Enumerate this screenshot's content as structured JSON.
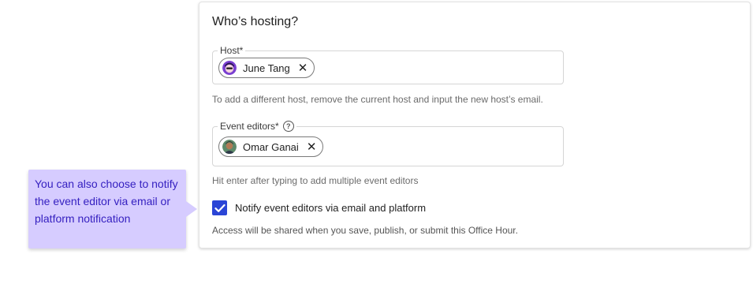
{
  "hosting": {
    "section_title": "Who’s hosting?",
    "host_field": {
      "label": "Host*",
      "chip": {
        "name": "June Tang",
        "remove_icon": "close-icon"
      },
      "helper": "To add a different host, remove the current host and input the new host’s email."
    },
    "editors_field": {
      "label": "Event editors*",
      "help_icon": "help-circle-icon",
      "help_glyph": "?",
      "chip": {
        "name": "Omar Ganai",
        "remove_icon": "close-icon"
      },
      "helper": "Hit enter after typing to add multiple event editors"
    },
    "notify": {
      "checked": true,
      "label": "Notify event editors via email and platform"
    },
    "access_note": "Access will be shared when you save, publish, or submit this Office Hour."
  },
  "tooltip": {
    "text": "You can also choose to notify the event editor via email or platform notification"
  },
  "colors": {
    "accent": "#2b45d6",
    "tooltip_bg": "#d6ccff",
    "tooltip_text": "#3520c0"
  }
}
